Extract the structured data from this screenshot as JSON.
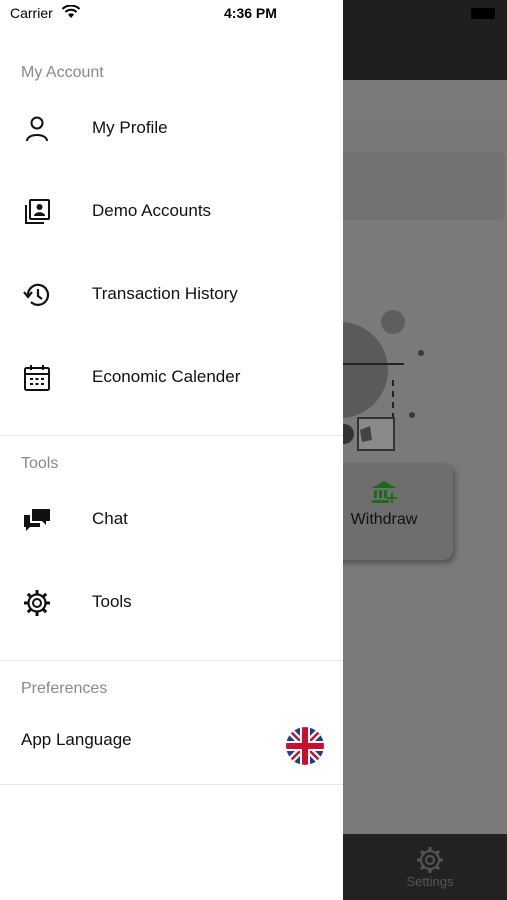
{
  "status_bar": {
    "carrier": "Carrier",
    "time": "4:36 PM"
  },
  "drawer": {
    "sections": {
      "account": {
        "title": "My Account",
        "items": [
          {
            "label": "My Profile",
            "icon": "person-icon"
          },
          {
            "label": "Demo Accounts",
            "icon": "contacts-icon"
          },
          {
            "label": "Transaction History",
            "icon": "history-icon"
          },
          {
            "label": "Economic Calender",
            "icon": "calendar-icon"
          }
        ]
      },
      "tools": {
        "title": "Tools",
        "items": [
          {
            "label": "Chat",
            "icon": "chat-icon"
          },
          {
            "label": "Tools",
            "icon": "gear-icon"
          }
        ]
      },
      "preferences": {
        "title": "Preferences",
        "items": [
          {
            "label": "App Language",
            "icon": "uk-flag-icon"
          }
        ]
      }
    }
  },
  "background": {
    "withdraw_label": "Withdraw",
    "tab_settings_label": "Settings"
  },
  "colors": {
    "drawer_bg": "#ffffff",
    "section_title": "#8a8a8a",
    "dimmed_overlay": "#7a7a7a",
    "withdraw_icon": "#1b6b1b"
  }
}
